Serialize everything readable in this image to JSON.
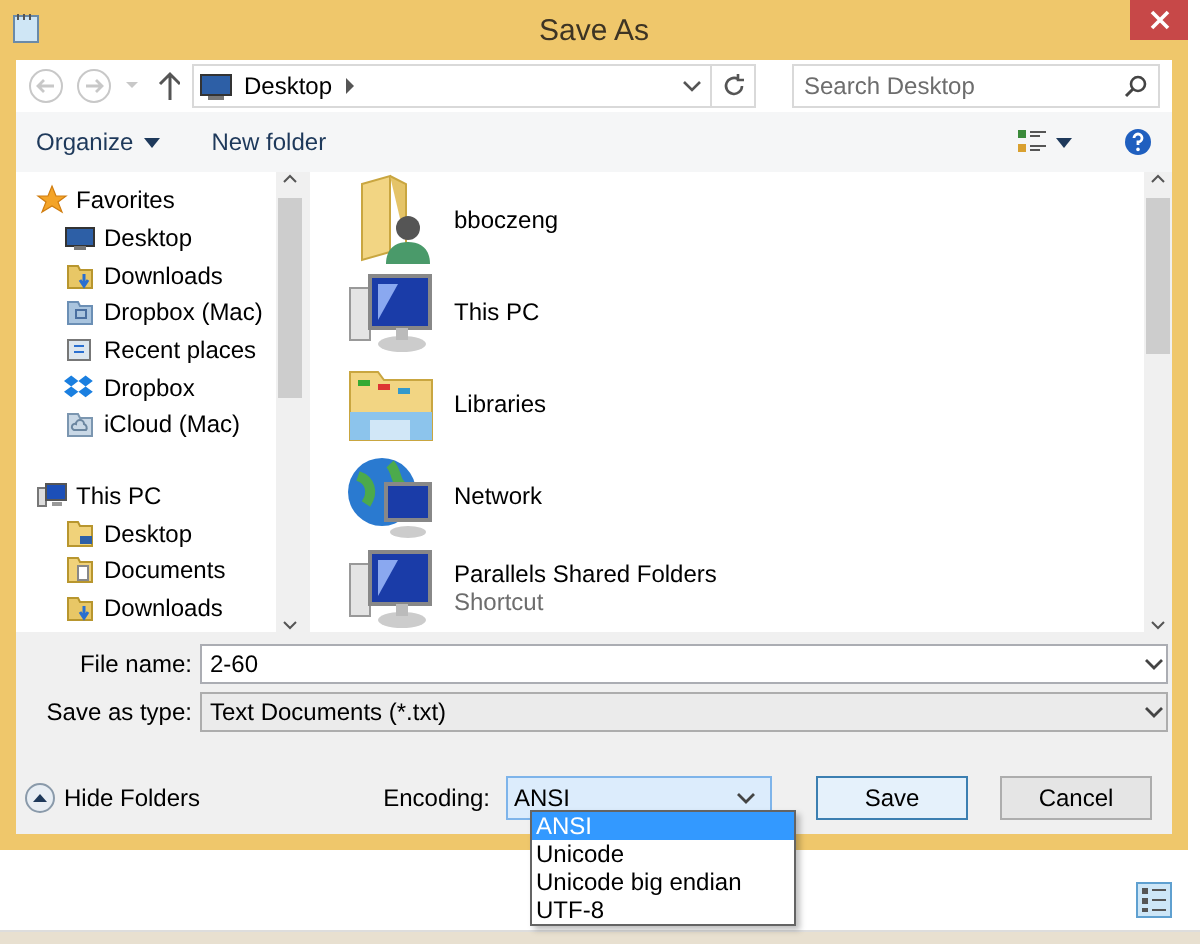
{
  "window": {
    "title": "Save As"
  },
  "nav": {
    "address": "Desktop",
    "search": {
      "placeholder": "Search Desktop"
    }
  },
  "toolbar": {
    "organize": "Organize",
    "new_folder": "New folder"
  },
  "sidebar": {
    "groups": [
      {
        "label": "Favorites",
        "kind": "star",
        "children": [
          {
            "label": "Desktop",
            "kind": "desktop"
          },
          {
            "label": "Downloads",
            "kind": "downloads"
          },
          {
            "label": "Dropbox (Mac)",
            "kind": "box"
          },
          {
            "label": "Recent places",
            "kind": "recent"
          },
          {
            "label": "Dropbox",
            "kind": "dropbox"
          },
          {
            "label": "iCloud (Mac)",
            "kind": "cloud"
          }
        ]
      },
      {
        "label": "This PC",
        "kind": "pc",
        "children": [
          {
            "label": "Desktop",
            "kind": "desktop-folder"
          },
          {
            "label": "Documents",
            "kind": "documents"
          },
          {
            "label": "Downloads",
            "kind": "downloads"
          }
        ]
      }
    ]
  },
  "items": [
    {
      "name": "bboczeng",
      "kind": "user"
    },
    {
      "name": "This PC",
      "kind": "pc"
    },
    {
      "name": "Libraries",
      "kind": "libraries"
    },
    {
      "name": "Network",
      "kind": "network"
    },
    {
      "name": "Parallels Shared Folders",
      "subtitle": "Shortcut",
      "kind": "pc"
    }
  ],
  "form": {
    "file_name_label": "File name:",
    "file_name": "2-60",
    "type_label": "Save as type:",
    "type": "Text Documents (*.txt)"
  },
  "hide_folders": "Hide Folders",
  "encoding": {
    "label": "Encoding:",
    "value": "ANSI",
    "expanded": true,
    "options": [
      {
        "label": "ANSI",
        "selected": true
      },
      {
        "label": "Unicode",
        "selected": false
      },
      {
        "label": "Unicode big endian",
        "selected": false
      },
      {
        "label": "UTF-8",
        "selected": false
      }
    ]
  },
  "buttons": [
    {
      "label": "Save",
      "default": true
    },
    {
      "label": "Cancel",
      "default": false
    }
  ]
}
